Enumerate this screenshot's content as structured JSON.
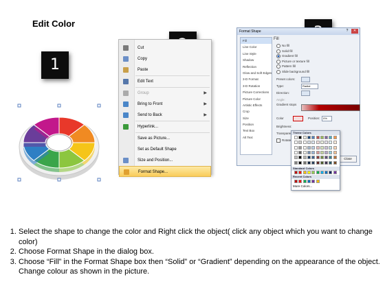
{
  "title": "Edit Color",
  "step_numbers": [
    "1",
    "2",
    "3"
  ],
  "context_menu": {
    "items": [
      {
        "label": "Cut",
        "icon": "scissors-icon",
        "disabled": false
      },
      {
        "label": "Copy",
        "icon": "copy-icon",
        "disabled": false
      },
      {
        "label": "Paste",
        "icon": "paste-icon",
        "disabled": false
      },
      {
        "label": "Edit Text",
        "icon": "edit-text-icon",
        "disabled": false
      },
      {
        "label": "Group",
        "icon": "group-icon",
        "disabled": true,
        "submenu": true
      },
      {
        "label": "Bring to Front",
        "icon": "bring-front-icon",
        "disabled": false,
        "submenu": true
      },
      {
        "label": "Send to Back",
        "icon": "send-back-icon",
        "disabled": false,
        "submenu": true
      },
      {
        "label": "Hyperlink...",
        "icon": "hyperlink-icon",
        "disabled": false
      },
      {
        "label": "Save as Picture...",
        "icon": "",
        "disabled": false
      },
      {
        "label": "Set as Default Shape",
        "icon": "",
        "disabled": false
      },
      {
        "label": "Size and Position...",
        "icon": "size-position-icon",
        "disabled": false
      },
      {
        "label": "Format Shape...",
        "icon": "format-shape-icon",
        "disabled": false,
        "highlighted": true
      }
    ]
  },
  "format_dialog": {
    "title": "Format Shape",
    "nav_items": [
      "Fill",
      "Line Color",
      "Line Style",
      "Shadow",
      "Reflection",
      "Glow and Soft Edges",
      "3-D Format",
      "3-D Rotation",
      "Picture Corrections",
      "Picture Color",
      "Artistic Effects",
      "Crop",
      "Size",
      "Position",
      "Text Box",
      "Alt Text"
    ],
    "section": "Fill",
    "fill_options": [
      "No fill",
      "Solid fill",
      "Gradient fill",
      "Picture or texture fill",
      "Pattern fill",
      "Slide background fill"
    ],
    "selected_fill": "Gradient fill",
    "labels": {
      "preset": "Preset colors:",
      "type": "Type:",
      "type_value": "Radial",
      "direction": "Direction:",
      "angle": "Angle:",
      "stops": "Gradient stops",
      "color": "Color",
      "position": "Position:",
      "position_value": "0%",
      "brightness": "Brightness:",
      "transparency": "Transparency:",
      "rotate": "Rotate with shape",
      "close": "Close"
    },
    "palette": {
      "theme_title": "Theme Colors",
      "standard_title": "Standard Colors",
      "recent_title": "Recent Colors",
      "more": "More Colors...",
      "theme_top": [
        "#ffffff",
        "#000000",
        "#eeece1",
        "#1f497d",
        "#4f81bd",
        "#c0504d",
        "#9bbb59",
        "#8064a2",
        "#4bacc6",
        "#f79646"
      ],
      "standard": [
        "#c00000",
        "#ff0000",
        "#ffc000",
        "#ffff00",
        "#92d050",
        "#00b050",
        "#00b0f0",
        "#0070c0",
        "#002060",
        "#7030a0"
      ],
      "recent": [
        "#c00000",
        "#ff0000",
        "#00b050",
        "#0070c0",
        "#7030a0",
        "#ffc000"
      ]
    }
  },
  "instructions": [
    "Select the shape to change the color and Right click the object( click any object which you want to change color)",
    "Choose Format Shape in the dialog box.",
    "Choose “Fill” in the Format Shape box then “Solid” or “Gradient” depending on the appearance of the object. Change colour as shown in the picture."
  ],
  "ring_colors": [
    "#e8382a",
    "#f08a22",
    "#f5c518",
    "#8cc63f",
    "#3aa54a",
    "#2e7fc4",
    "#6a3d9a",
    "#c2188b"
  ]
}
